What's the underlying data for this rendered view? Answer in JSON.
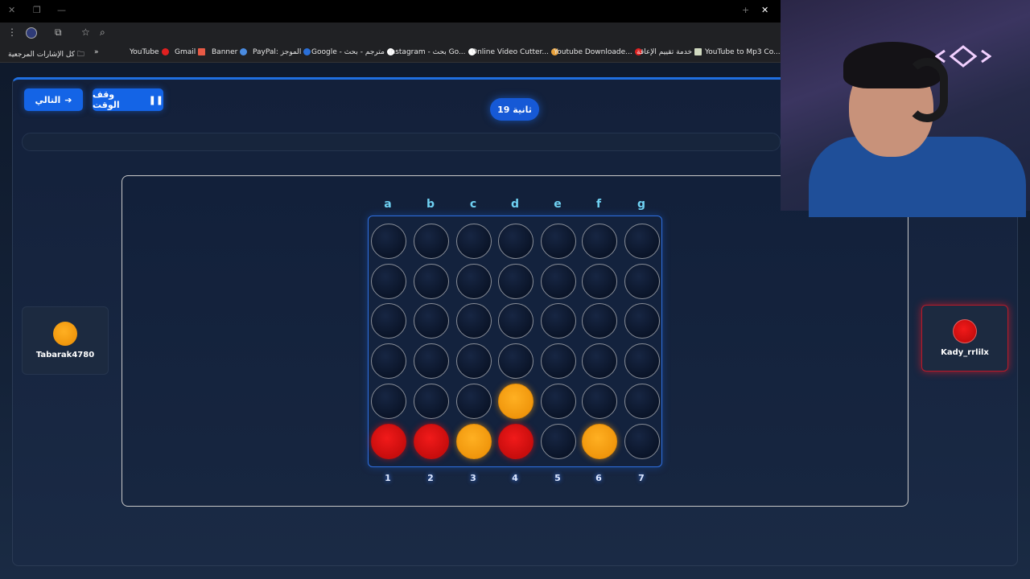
{
  "browser": {
    "bookmarks": [
      {
        "label": "كل الإشارات المرجعية"
      },
      {
        "label": "YouTube"
      },
      {
        "label": "Gmail"
      },
      {
        "label": "Banner"
      },
      {
        "label": "PayPal: الموجز"
      },
      {
        "label": "Google - مترجم - بحث"
      },
      {
        "label": "instagram - بحث Go..."
      },
      {
        "label": "Online Video Cutter..."
      },
      {
        "label": "Youtube Downloade..."
      },
      {
        "label": "خدمة تقييم الإعاقة"
      },
      {
        "label": "YouTube to Mp3 Co..."
      }
    ]
  },
  "controls": {
    "next_label": "التالي",
    "pause_label": "وقف الوقت",
    "timer_label": "19 ثانية"
  },
  "board": {
    "columns_letters": [
      "a",
      "b",
      "c",
      "d",
      "e",
      "f",
      "g"
    ],
    "columns_numbers": [
      "1",
      "2",
      "3",
      "4",
      "5",
      "6",
      "7"
    ],
    "rows": 6,
    "cols": 7,
    "cells": [
      [
        "empty",
        "empty",
        "empty",
        "empty",
        "empty",
        "empty",
        "empty"
      ],
      [
        "empty",
        "empty",
        "empty",
        "empty",
        "empty",
        "empty",
        "empty"
      ],
      [
        "empty",
        "empty",
        "empty",
        "empty",
        "empty",
        "empty",
        "empty"
      ],
      [
        "empty",
        "empty",
        "empty",
        "empty",
        "empty",
        "empty",
        "empty"
      ],
      [
        "empty",
        "empty",
        "empty",
        "yellow",
        "empty",
        "empty",
        "empty"
      ],
      [
        "red",
        "red",
        "yellow",
        "red",
        "empty",
        "yellow",
        "empty"
      ]
    ]
  },
  "players": {
    "left": {
      "name": "Tabarak4780",
      "color": "yellow"
    },
    "right": {
      "name": "Kady_rrlilx",
      "color": "red",
      "active": true
    }
  },
  "colors": {
    "accent": "#1464e6",
    "red_piece": "#e01010",
    "yellow_piece": "#f5a016",
    "column_letter": "#6fd1f2"
  }
}
